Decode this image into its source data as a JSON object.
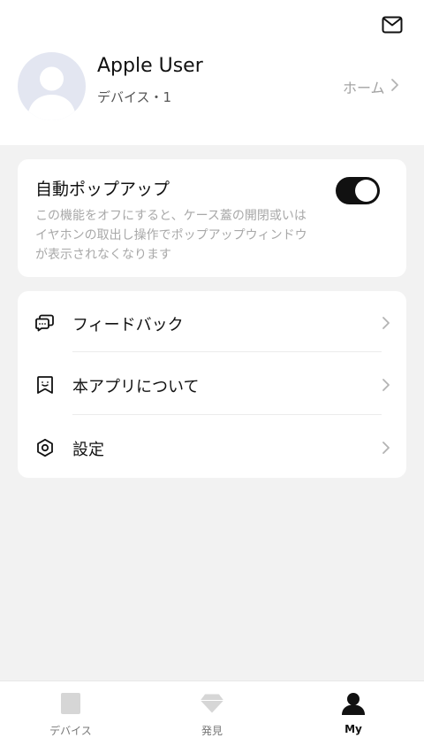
{
  "header": {
    "mail_icon": "mail-icon",
    "username": "Apple User",
    "device_count": "デバイス・1",
    "home_label": "ホーム"
  },
  "popup_card": {
    "title": "自動ポップアップ",
    "description": "この機能をオフにすると、ケース蓋の開閉或いはイヤホンの取出し操作でポップアップウィンドウが表示されなくなります",
    "toggle_on": true,
    "toggle_color": "#111111"
  },
  "menu": {
    "items": [
      {
        "label": "フィードバック",
        "icon": "feedback-icon"
      },
      {
        "label": "本アプリについて",
        "icon": "about-icon"
      },
      {
        "label": "設定",
        "icon": "settings-icon"
      }
    ]
  },
  "tabbar": {
    "tabs": [
      {
        "label": "デバイス",
        "icon": "device-icon",
        "active": false
      },
      {
        "label": "発見",
        "icon": "discover-icon",
        "active": false
      },
      {
        "label": "My",
        "icon": "profile-icon",
        "active": true
      }
    ]
  },
  "colors": {
    "background": "#f2f2f2",
    "card": "#ffffff",
    "accent": "#111111",
    "muted_text": "#a8a8a8"
  }
}
